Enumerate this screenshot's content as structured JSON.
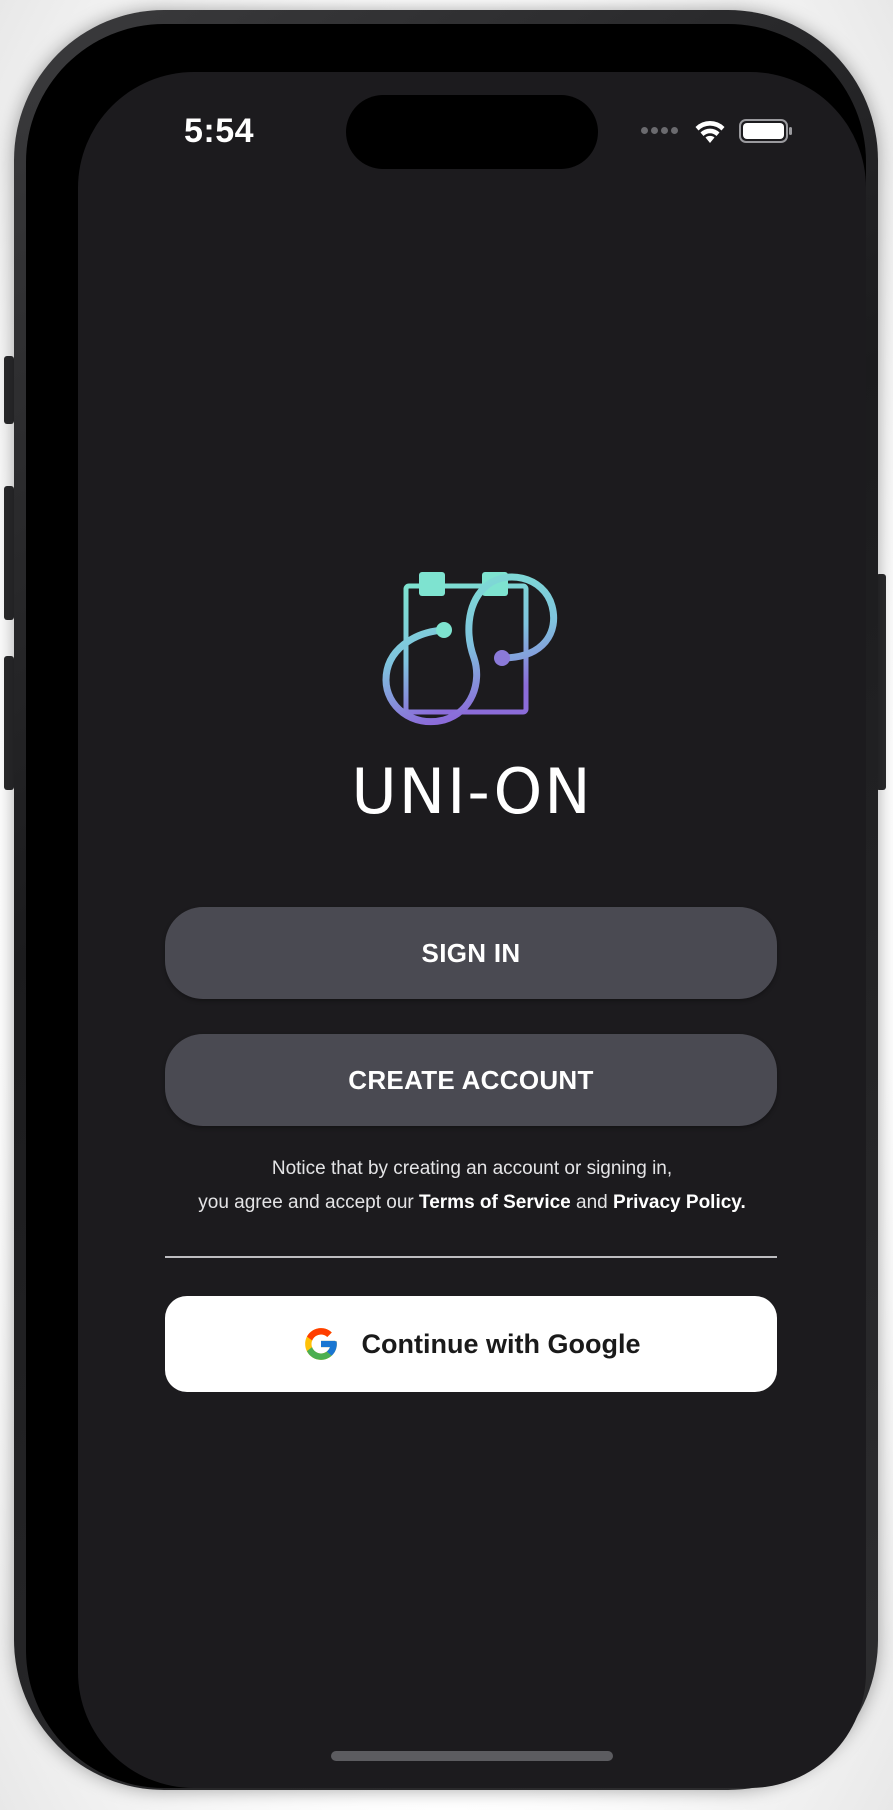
{
  "status_bar": {
    "time": "5:54",
    "wifi_icon": "wifi-icon",
    "battery_icon": "battery-icon"
  },
  "brand": {
    "name": "UNI-ON",
    "logo_icon": "calendar-infinity-logo",
    "logo_colors": [
      "#7ee3d0",
      "#8b6cd9"
    ]
  },
  "buttons": {
    "sign_in": "SIGN IN",
    "create_account": "CREATE ACCOUNT",
    "google": "Continue with Google"
  },
  "notice": {
    "line1": "Notice that by creating an account or signing in,",
    "line2_prefix": "you agree and accept our ",
    "terms": "Terms of Service",
    "and": " and ",
    "privacy": "Privacy Policy."
  },
  "colors": {
    "background": "#1c1b1e",
    "button": "#4a4a52",
    "google_button": "#ffffff"
  }
}
